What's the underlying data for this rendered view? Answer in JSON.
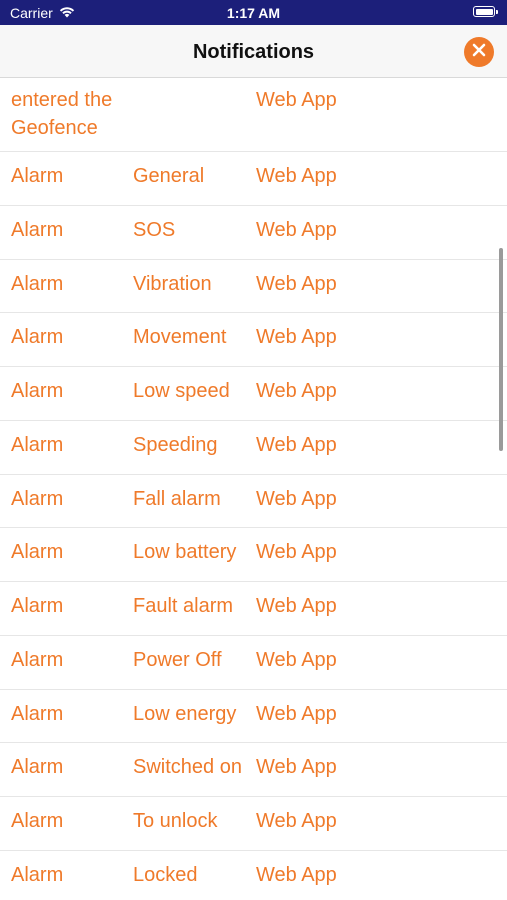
{
  "status_bar": {
    "carrier": "Carrier",
    "time": "1:17 AM"
  },
  "nav": {
    "title": "Notifications"
  },
  "colors": {
    "accent": "#ef7a2a",
    "status_bar_bg": "#1c1f7a",
    "nav_bg": "#f7f7f7"
  },
  "icons": {
    "wifi": "wifi-icon",
    "battery": "battery-icon",
    "close": "close-icon"
  },
  "rows": [
    {
      "type": "entered the Geofence",
      "name": "",
      "source": "Web App"
    },
    {
      "type": "Alarm",
      "name": "General",
      "source": "Web App"
    },
    {
      "type": "Alarm",
      "name": "SOS",
      "source": "Web App"
    },
    {
      "type": "Alarm",
      "name": "Vibration",
      "source": "Web App"
    },
    {
      "type": "Alarm",
      "name": "Movement",
      "source": "Web App"
    },
    {
      "type": "Alarm",
      "name": "Low speed",
      "source": "Web App"
    },
    {
      "type": "Alarm",
      "name": "Speeding",
      "source": "Web App"
    },
    {
      "type": "Alarm",
      "name": "Fall alarm",
      "source": "Web App"
    },
    {
      "type": "Alarm",
      "name": "Low battery",
      "source": "Web App"
    },
    {
      "type": "Alarm",
      "name": "Fault alarm",
      "source": "Web App"
    },
    {
      "type": "Alarm",
      "name": "Power Off",
      "source": "Web App"
    },
    {
      "type": "Alarm",
      "name": "Low energy",
      "source": "Web App"
    },
    {
      "type": "Alarm",
      "name": "Switched on",
      "source": "Web App"
    },
    {
      "type": "Alarm",
      "name": "To unlock",
      "source": "Web App"
    },
    {
      "type": "Alarm",
      "name": "Locked",
      "source": "Web App"
    }
  ]
}
